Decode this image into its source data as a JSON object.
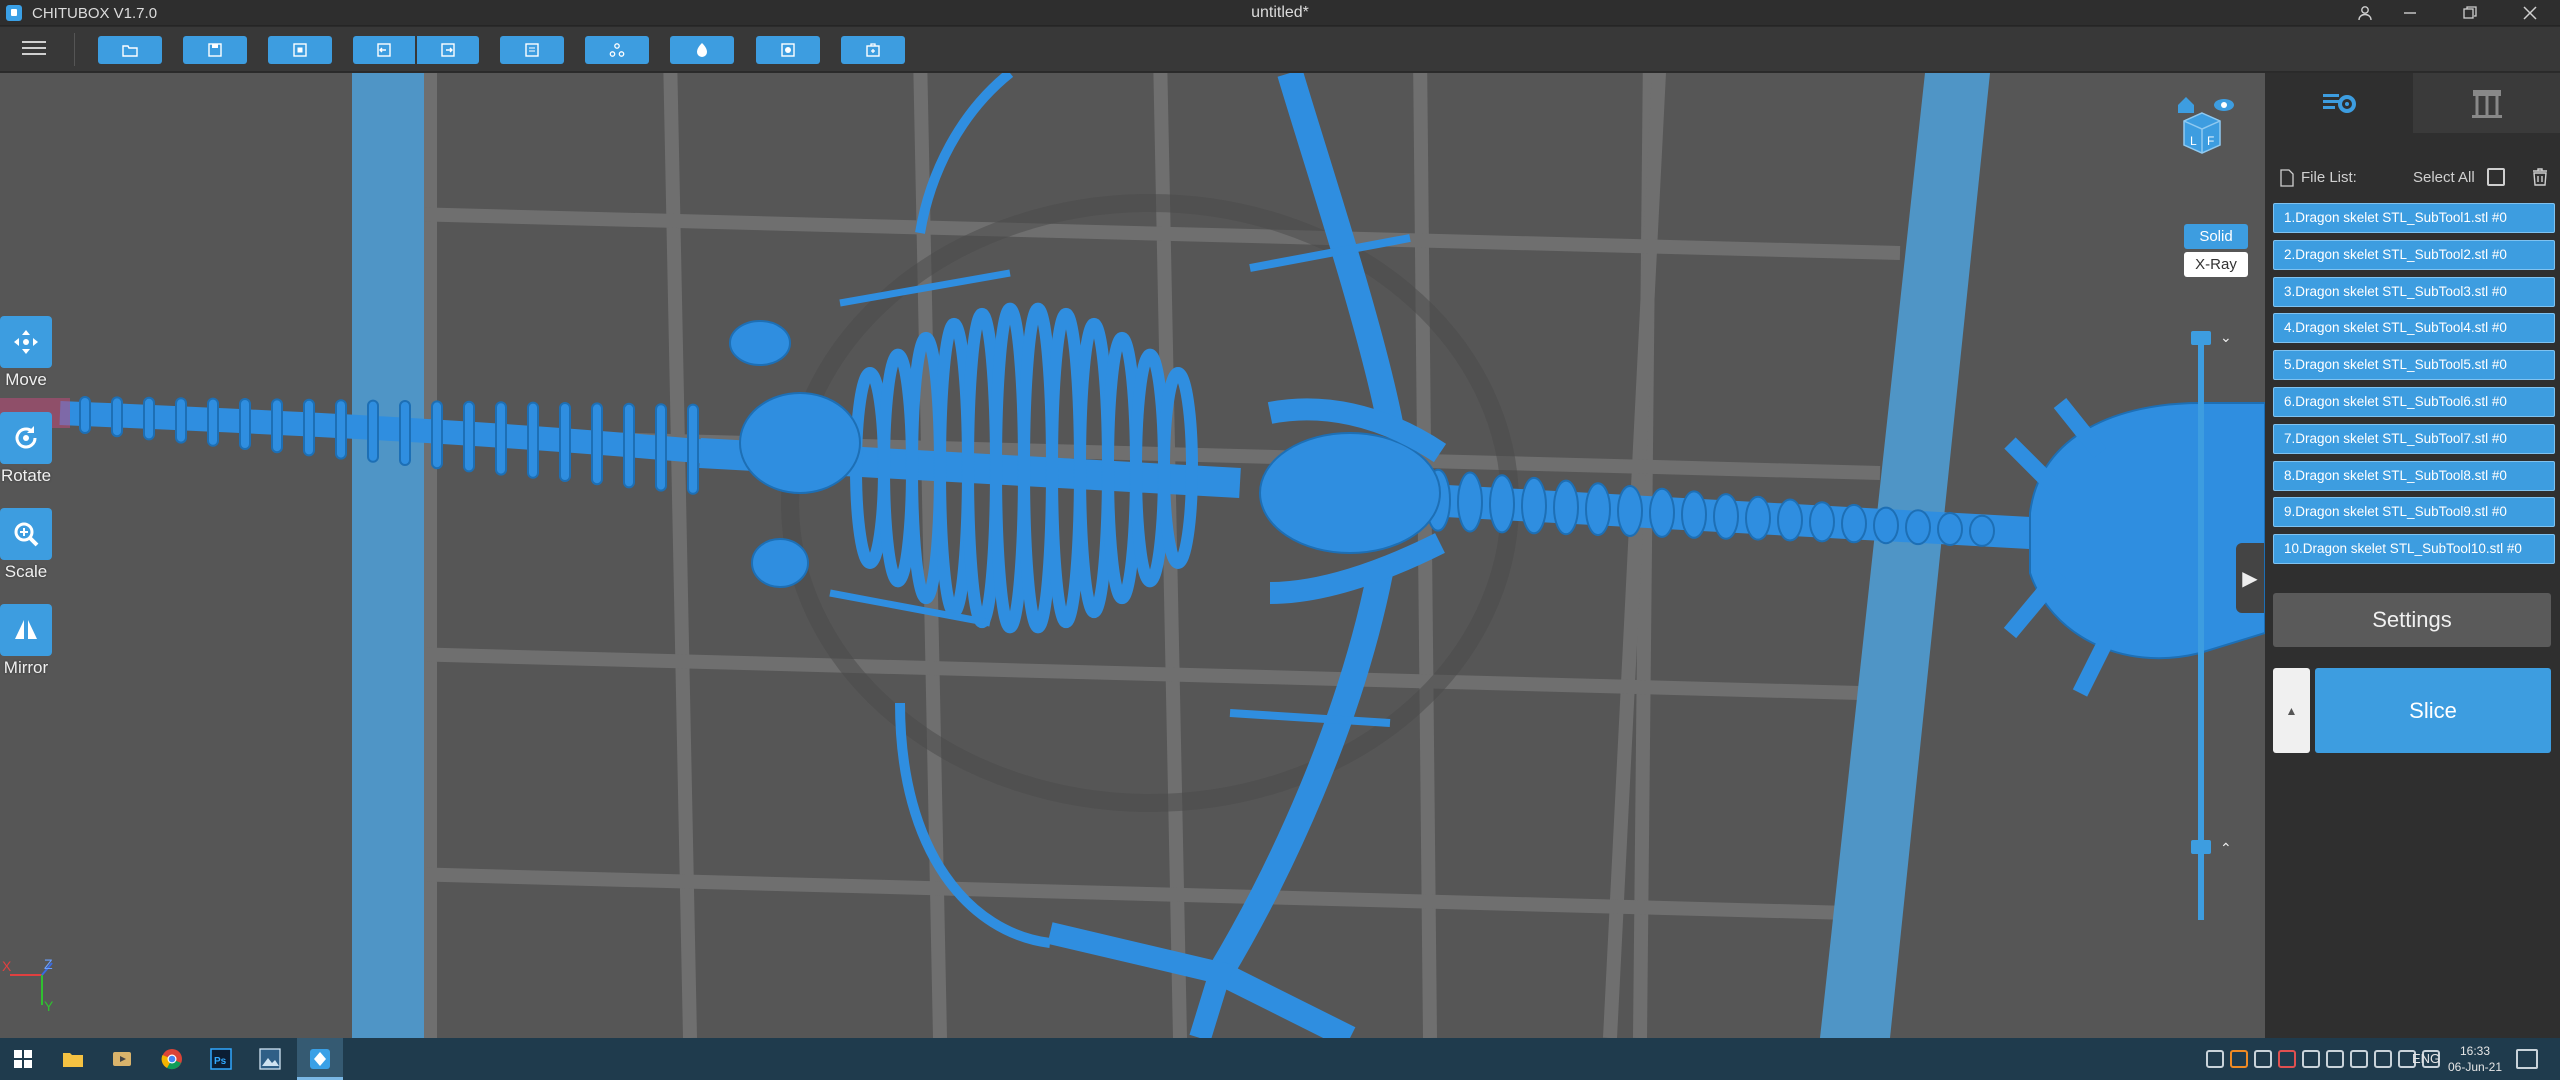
{
  "app": {
    "title": "CHITUBOX V1.7.0",
    "document_title": "untitled*"
  },
  "window_controls": [
    "account-icon",
    "minimize-icon",
    "restore-icon",
    "close-icon"
  ],
  "toolbar": {
    "buttons": [
      "open-file-icon",
      "save-icon",
      "fit-icon",
      "undo-icon",
      "redo-icon",
      "list-icon",
      "support-icon",
      "hollow-icon",
      "dig-hole-icon",
      "layout-icon"
    ]
  },
  "tools": [
    {
      "label": "Move",
      "icon": "move-icon"
    },
    {
      "label": "Rotate",
      "icon": "rotate-icon"
    },
    {
      "label": "Scale",
      "icon": "scale-icon"
    },
    {
      "label": "Mirror",
      "icon": "mirror-icon"
    }
  ],
  "render_mode": {
    "solid": "Solid",
    "xray": "X-Ray",
    "selected": "Solid"
  },
  "axis": {
    "x": "X",
    "y": "Y",
    "z": "Z"
  },
  "view_cube": {
    "faces": [
      "L",
      "F"
    ]
  },
  "panel": {
    "file_list_label": "File List:",
    "select_all_label": "Select All",
    "files": [
      "1.Dragon skelet STL_SubTool1.stl #0",
      "2.Dragon skelet STL_SubTool2.stl #0",
      "3.Dragon skelet STL_SubTool3.stl #0",
      "4.Dragon skelet STL_SubTool4.stl #0",
      "5.Dragon skelet STL_SubTool5.stl #0",
      "6.Dragon skelet STL_SubTool6.stl #0",
      "7.Dragon skelet STL_SubTool7.stl #0",
      "8.Dragon skelet STL_SubTool8.stl #0",
      "9.Dragon skelet STL_SubTool9.stl #0",
      "10.Dragon skelet STL_SubTool10.stl #0"
    ],
    "settings_label": "Settings",
    "slice_label": "Slice"
  },
  "taskbar": {
    "language": "ENG",
    "time": "16:33",
    "date": "06-Jun-21",
    "apps": [
      "start-icon",
      "file-explorer-icon",
      "media-player-icon",
      "chrome-icon",
      "photoshop-icon",
      "photos-icon",
      "chitubox-icon"
    ]
  },
  "colors": {
    "accent": "#3d9de0",
    "viewport": "#565656",
    "panel": "#2f2f2f",
    "taskbar": "#1f3b4d"
  }
}
